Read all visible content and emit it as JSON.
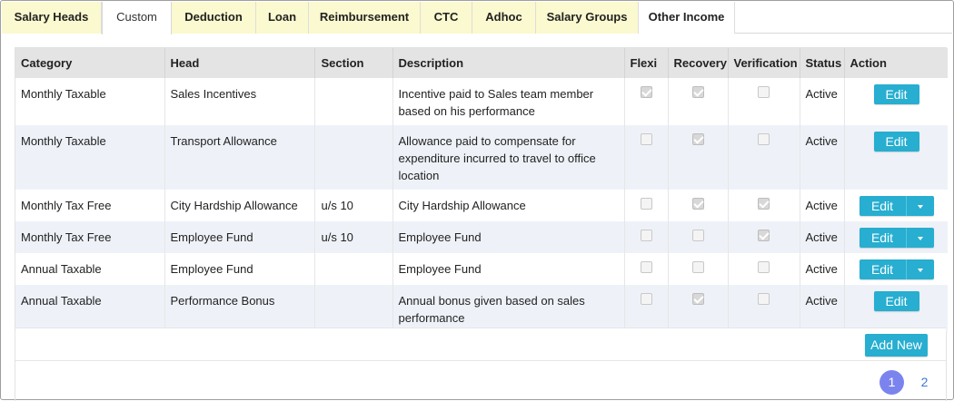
{
  "tabs": [
    {
      "label": "Salary Heads",
      "width": 110,
      "style": "yellow"
    },
    {
      "label": "Custom",
      "width": 77,
      "style": "active"
    },
    {
      "label": "Deduction",
      "width": 93,
      "style": "yellow"
    },
    {
      "label": "Loan",
      "width": 58,
      "style": "yellow"
    },
    {
      "label": "Reimbursement",
      "width": 123,
      "style": "yellow"
    },
    {
      "label": "CTC",
      "width": 57,
      "style": "yellow"
    },
    {
      "label": "Adhoc",
      "width": 70,
      "style": "yellow"
    },
    {
      "label": "Salary Groups",
      "width": 113,
      "style": "yellow"
    },
    {
      "label": "Other Income",
      "width": 106,
      "style": "plain"
    }
  ],
  "table": {
    "headers": {
      "category": "Category",
      "head": "Head",
      "section": "Section",
      "description": "Description",
      "flexi": "Flexi",
      "recovery": "Recovery",
      "verification": "Verification",
      "status": "Status",
      "action": "Action"
    },
    "rows": [
      {
        "category": "Monthly Taxable",
        "head": "Sales Incentives",
        "section": "",
        "description": "Incentive paid to Sales team member based on his performance",
        "flexi": true,
        "recovery": true,
        "verification": false,
        "status": "Active",
        "action": "Edit",
        "dropdown": false
      },
      {
        "category": "Monthly Taxable",
        "head": "Transport Allowance",
        "section": "",
        "description": "Allowance paid to compensate for expenditure incurred to travel to office location",
        "flexi": false,
        "recovery": true,
        "verification": false,
        "status": "Active",
        "action": "Edit",
        "dropdown": false
      },
      {
        "category": "Monthly Tax Free",
        "head": "City Hardship Allowance",
        "section": "u/s 10",
        "description": "City Hardship Allowance",
        "flexi": false,
        "recovery": true,
        "verification": true,
        "status": "Active",
        "action": "Edit",
        "dropdown": true
      },
      {
        "category": "Monthly Tax Free",
        "head": "Employee Fund",
        "section": "u/s 10",
        "description": "Employee Fund",
        "flexi": false,
        "recovery": false,
        "verification": true,
        "status": "Active",
        "action": "Edit",
        "dropdown": true
      },
      {
        "category": "Annual Taxable",
        "head": "Employee Fund",
        "section": "",
        "description": "Employee Fund",
        "flexi": false,
        "recovery": false,
        "verification": false,
        "status": "Active",
        "action": "Edit",
        "dropdown": true
      },
      {
        "category": "Annual Taxable",
        "head": "Performance Bonus",
        "section": "",
        "description": "Annual bonus given based on sales performance",
        "flexi": false,
        "recovery": true,
        "verification": false,
        "status": "Active",
        "action": "Edit",
        "dropdown": false
      }
    ]
  },
  "add_new_label": "Add New",
  "pagination": {
    "pages": [
      "1",
      "2"
    ],
    "current": "1"
  },
  "colors": {
    "accent": "#27aed0",
    "tab_bg": "#fbf9cf",
    "row_alt": "#eef2f8",
    "page_active": "#7b84ee"
  }
}
